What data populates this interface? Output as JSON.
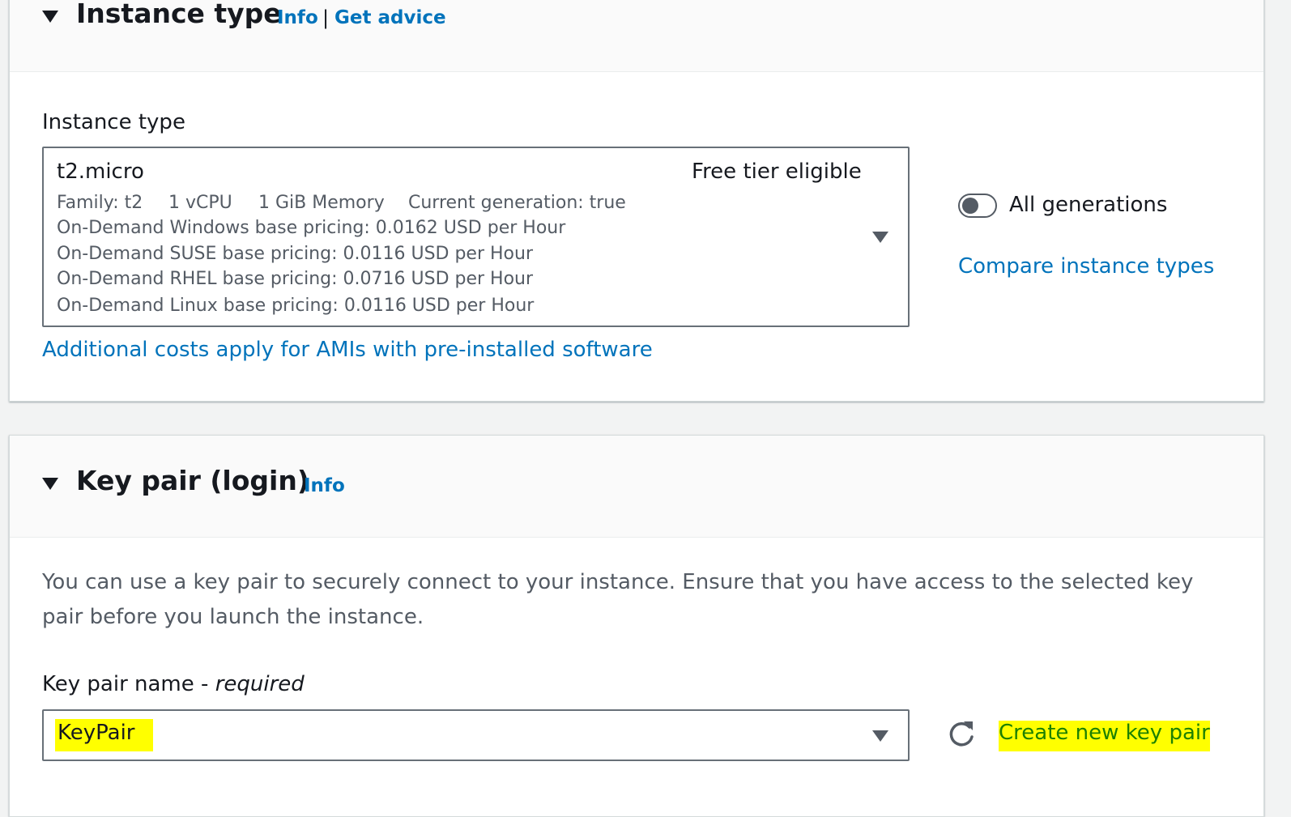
{
  "instance_type_section": {
    "title": "Instance type",
    "info_link": "Info",
    "separator": "|",
    "advice_link": "Get advice",
    "field_label": "Instance type",
    "selected": {
      "name": "t2.micro",
      "tag": "Free tier eligible",
      "family": "Family: t2",
      "vcpu": "1 vCPU",
      "memory": "1 GiB Memory",
      "generation": "Current generation: true",
      "pricing": [
        "On-Demand Windows base pricing: 0.0162 USD per Hour",
        "On-Demand SUSE base pricing: 0.0116 USD per Hour",
        "On-Demand RHEL base pricing: 0.0716 USD per Hour",
        "On-Demand Linux base pricing: 0.0116 USD per Hour"
      ]
    },
    "all_generations_label": "All generations",
    "all_generations_on": false,
    "compare_link": "Compare instance types",
    "additional_costs_link": "Additional costs apply for AMIs with pre-installed software"
  },
  "key_pair_section": {
    "title": "Key pair (login)",
    "info_link": "Info",
    "description": "You can use a key pair to securely connect to your instance. Ensure that you have access to the selected key pair before you launch the instance.",
    "field_label": "Key pair name",
    "field_label_dash": " - ",
    "field_required": "required",
    "selected_value": "KeyPair",
    "create_link": "Create new key pair"
  },
  "colors": {
    "link": "#0073bb",
    "highlight": "#ffff00",
    "text": "#16191f",
    "secondary_text": "#545b64"
  }
}
